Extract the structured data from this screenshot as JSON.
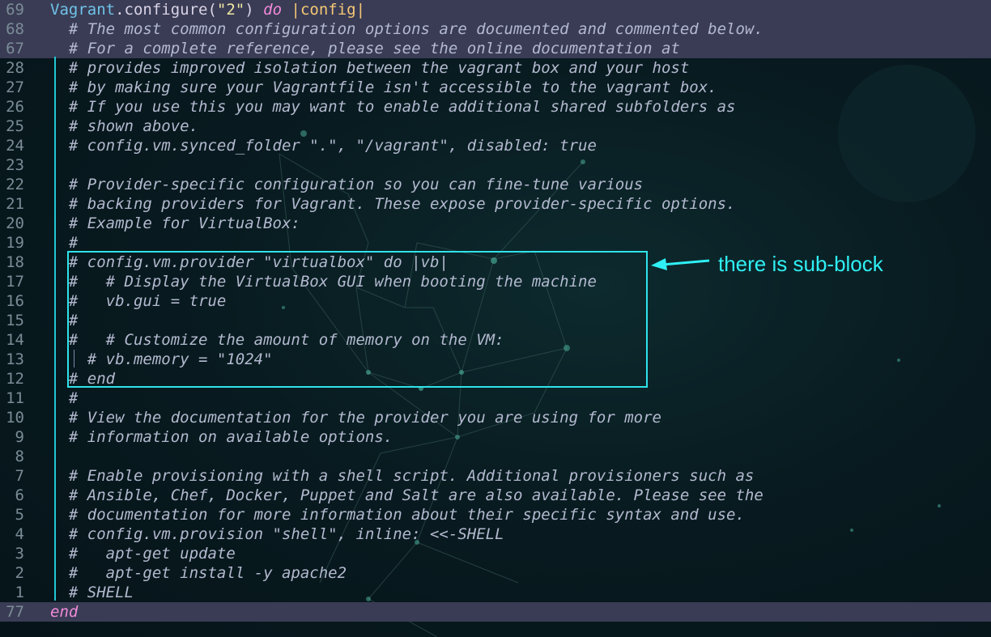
{
  "editor": {
    "lines": [
      {
        "num": "69",
        "text": "",
        "highlight": true,
        "type": "configure"
      },
      {
        "num": "68",
        "text": "  # The most common configuration options are documented and commented below.",
        "highlight": true,
        "type": "comment"
      },
      {
        "num": "67",
        "text": "  # For a complete reference, please see the online documentation at",
        "highlight": true,
        "type": "comment"
      },
      {
        "num": "28",
        "text": "  # provides improved isolation between the vagrant box and your host",
        "highlight": false,
        "type": "comment"
      },
      {
        "num": "27",
        "text": "  # by making sure your Vagrantfile isn't accessible to the vagrant box.",
        "highlight": false,
        "type": "comment"
      },
      {
        "num": "26",
        "text": "  # If you use this you may want to enable additional shared subfolders as",
        "highlight": false,
        "type": "comment"
      },
      {
        "num": "25",
        "text": "  # shown above.",
        "highlight": false,
        "type": "comment"
      },
      {
        "num": "24",
        "text": "  # config.vm.synced_folder \".\", \"/vagrant\", disabled: true",
        "highlight": false,
        "type": "comment"
      },
      {
        "num": "23",
        "text": "",
        "highlight": false,
        "type": "comment"
      },
      {
        "num": "22",
        "text": "  # Provider-specific configuration so you can fine-tune various",
        "highlight": false,
        "type": "comment"
      },
      {
        "num": "21",
        "text": "  # backing providers for Vagrant. These expose provider-specific options.",
        "highlight": false,
        "type": "comment"
      },
      {
        "num": "20",
        "text": "  # Example for VirtualBox:",
        "highlight": false,
        "type": "comment"
      },
      {
        "num": "19",
        "text": "  #",
        "highlight": false,
        "type": "comment"
      },
      {
        "num": "18",
        "text": "  # config.vm.provider \"virtualbox\" do |vb|",
        "highlight": false,
        "type": "comment"
      },
      {
        "num": "17",
        "text": "  #   # Display the VirtualBox GUI when booting the machine",
        "highlight": false,
        "type": "comment"
      },
      {
        "num": "16",
        "text": "  #   vb.gui = true",
        "highlight": false,
        "type": "comment"
      },
      {
        "num": "15",
        "text": "  #",
        "highlight": false,
        "type": "comment"
      },
      {
        "num": "14",
        "text": "  #   # Customize the amount of memory on the VM:",
        "highlight": false,
        "type": "comment"
      },
      {
        "num": "13",
        "text": "    # vb.memory = \"1024\"",
        "highlight": false,
        "type": "comment"
      },
      {
        "num": "12",
        "text": "  # end",
        "highlight": false,
        "type": "comment"
      },
      {
        "num": "11",
        "text": "  #",
        "highlight": false,
        "type": "comment"
      },
      {
        "num": "10",
        "text": "  # View the documentation for the provider you are using for more",
        "highlight": false,
        "type": "comment"
      },
      {
        "num": "9",
        "text": "  # information on available options.",
        "highlight": false,
        "type": "comment"
      },
      {
        "num": "8",
        "text": "",
        "highlight": false,
        "type": "comment"
      },
      {
        "num": "7",
        "text": "  # Enable provisioning with a shell script. Additional provisioners such as",
        "highlight": false,
        "type": "comment"
      },
      {
        "num": "6",
        "text": "  # Ansible, Chef, Docker, Puppet and Salt are also available. Please see the",
        "highlight": false,
        "type": "comment"
      },
      {
        "num": "5",
        "text": "  # documentation for more information about their specific syntax and use.",
        "highlight": false,
        "type": "comment"
      },
      {
        "num": "4",
        "text": "  # config.vm.provision \"shell\", inline: <<-SHELL",
        "highlight": false,
        "type": "comment"
      },
      {
        "num": "3",
        "text": "  #   apt-get update",
        "highlight": false,
        "type": "comment"
      },
      {
        "num": "2",
        "text": "  #   apt-get install -y apache2",
        "highlight": false,
        "type": "comment"
      },
      {
        "num": "1",
        "text": "  # SHELL",
        "highlight": false,
        "type": "comment"
      },
      {
        "num": "77",
        "text": "end",
        "highlight": true,
        "type": "end"
      }
    ],
    "configure_line": {
      "name": "Vagrant",
      "method": ".configure(",
      "arg": "\"2\"",
      "close": ")",
      "kw": "do",
      "block_arg": "|config|"
    }
  },
  "annotation": {
    "label": "there is sub-block",
    "color": "#2ff0f4"
  },
  "colors": {
    "comment": "#b3b9cf",
    "line_number": "#7b8c97",
    "highlight_bg": "#3a3c55",
    "guide": "#22c7d4",
    "keyword": "#f18ad8"
  }
}
